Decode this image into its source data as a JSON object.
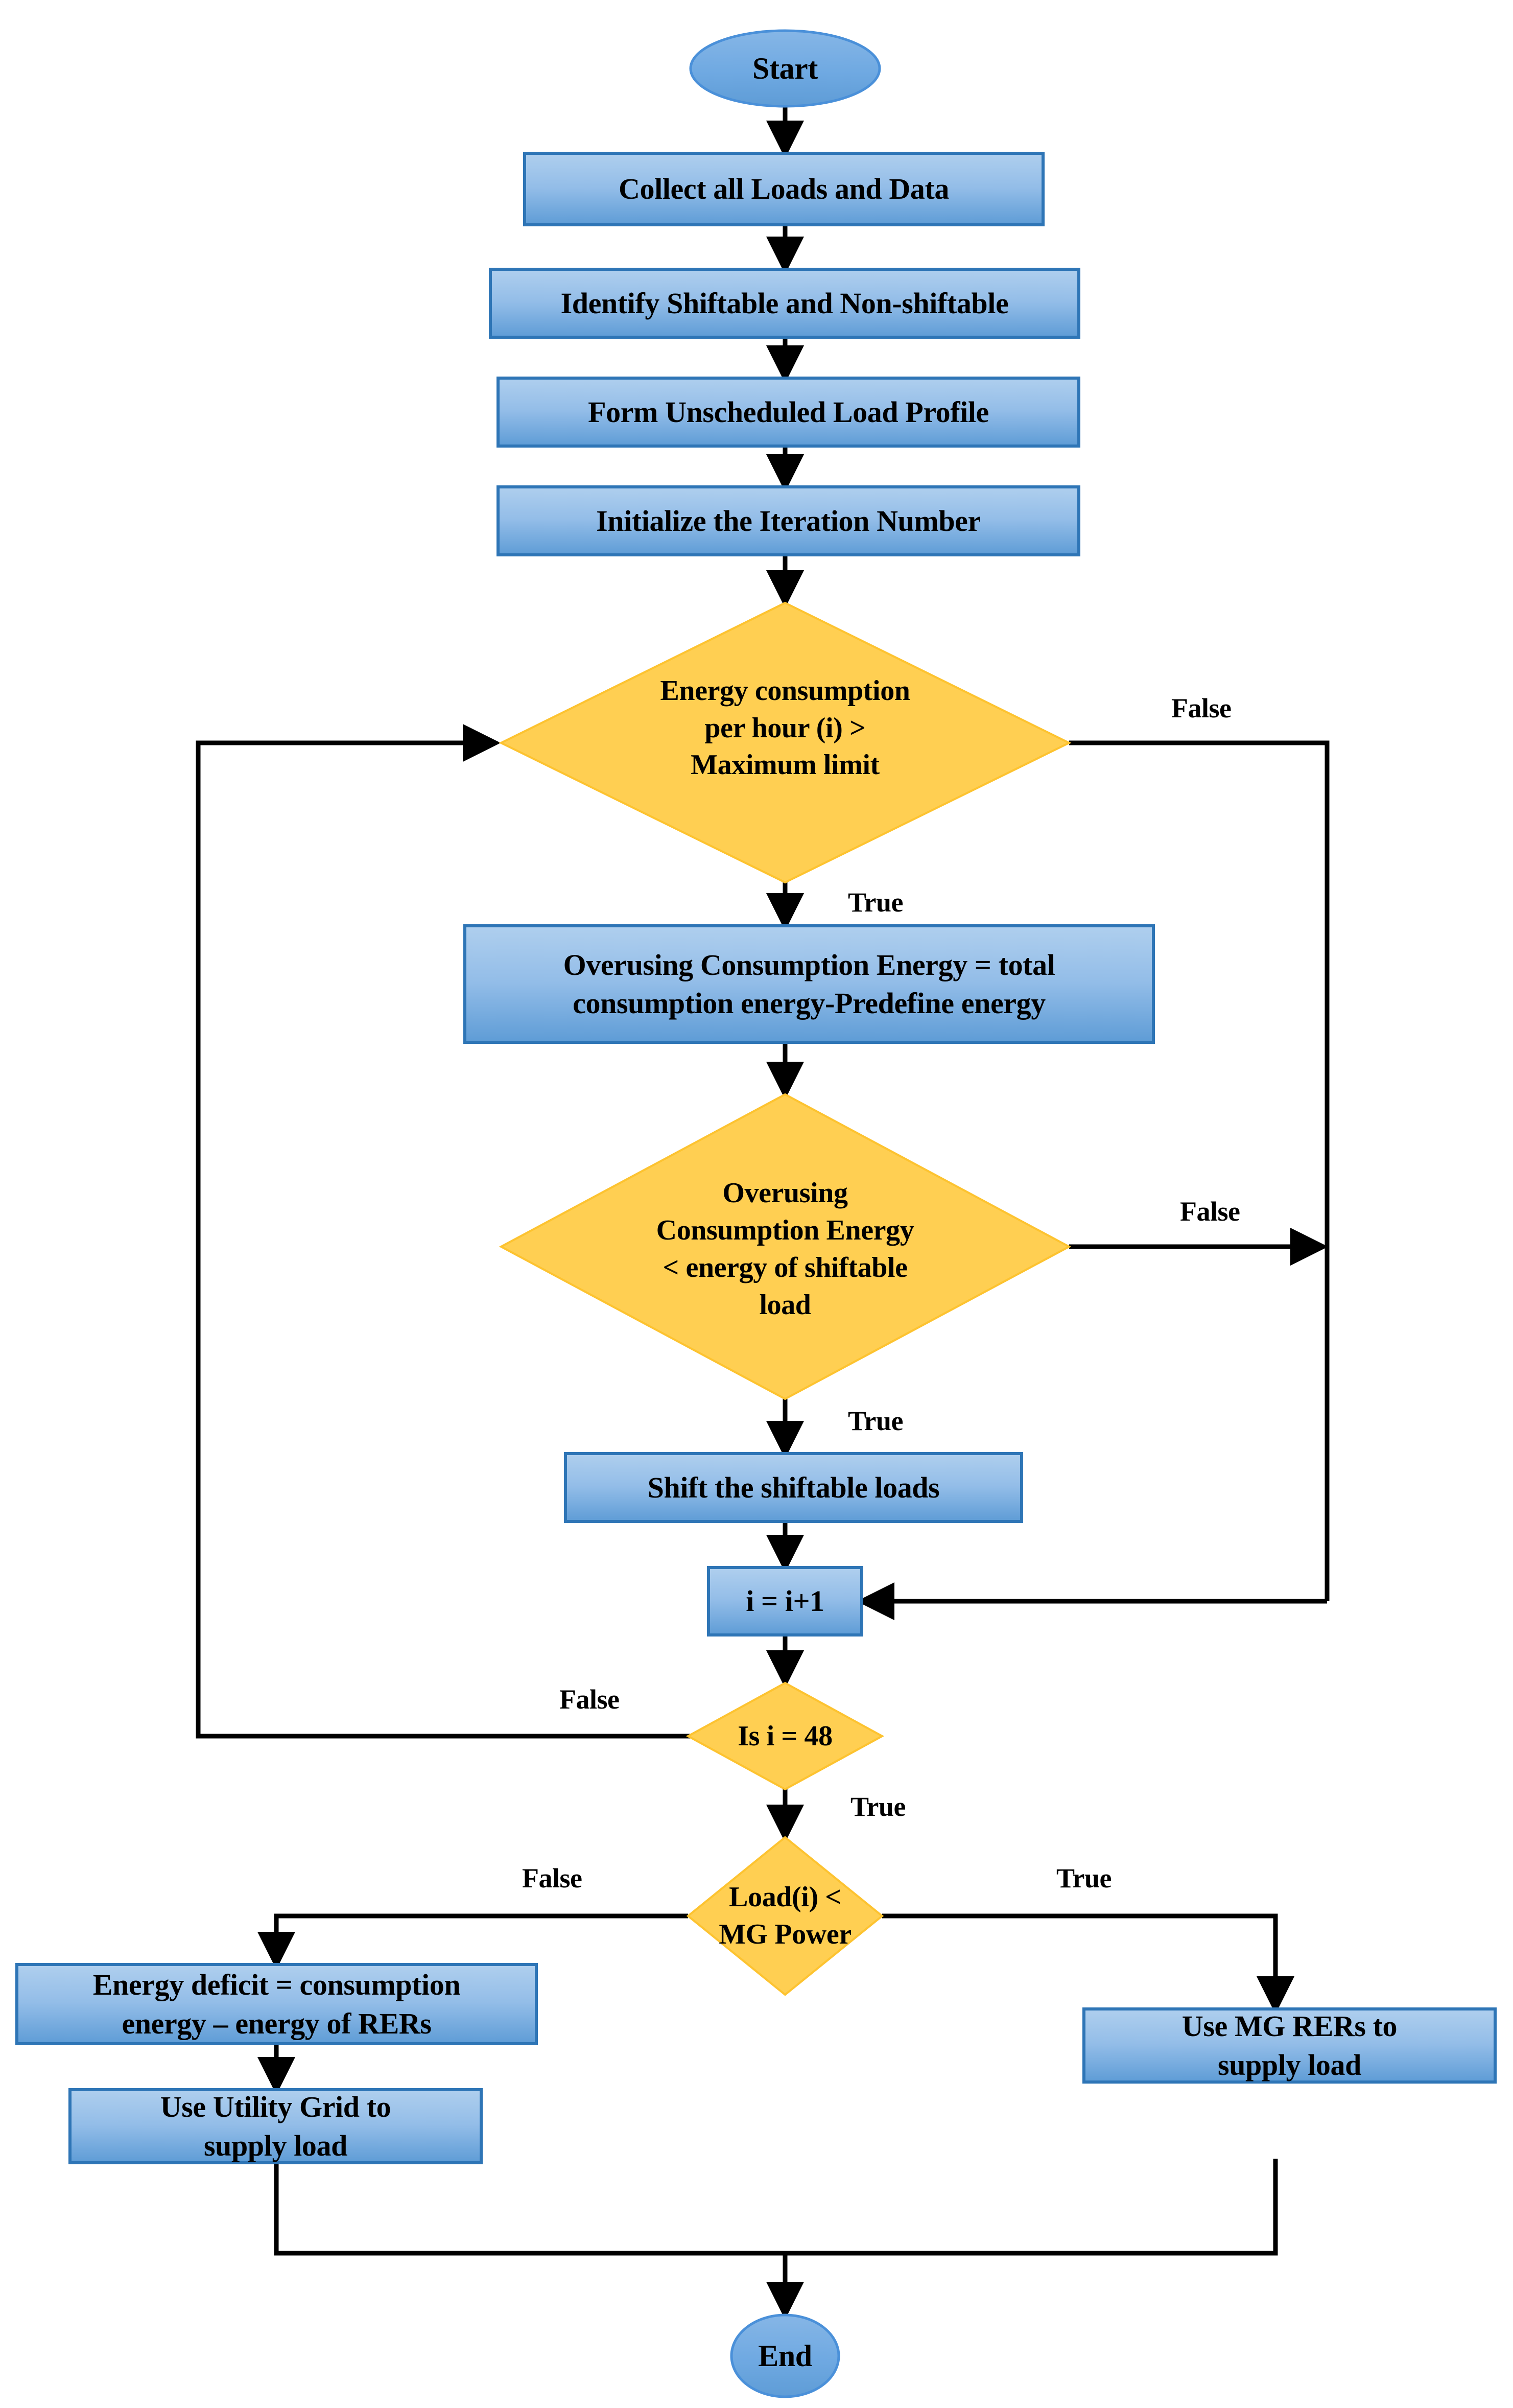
{
  "diagram": {
    "title": "Energy Management Load Scheduling Flowchart",
    "colors": {
      "process_fill_light": "#A8CBEC",
      "process_fill_dark": "#5B9BD5",
      "process_stroke": "#2E75B6",
      "decision_fill": "#FFCF52",
      "decision_stroke": "#FDC330",
      "terminal_fill": "#6FAAE4",
      "terminal_stroke": "#4A90D9",
      "connector": "#000000",
      "background": "#FFFFFF"
    },
    "nodes": {
      "start": {
        "shape": "terminal",
        "text": "Start"
      },
      "collect": {
        "shape": "process",
        "text": "Collect all Loads and Data"
      },
      "identify": {
        "shape": "process",
        "text": "Identify Shiftable and Non-shiftable"
      },
      "form_profile": {
        "shape": "process",
        "text": "Form Unscheduled Load Profile"
      },
      "init_iteration": {
        "shape": "process",
        "text": "Initialize the Iteration Number"
      },
      "decision_energy": {
        "shape": "decision",
        "text": "Energy consumption\nper hour (i) >\nMaximum limit"
      },
      "overusing_calc": {
        "shape": "process",
        "text": "Overusing Consumption Energy = total\nconsumption energy-Predefine energy"
      },
      "decision_overusing": {
        "shape": "decision",
        "text": "Overusing\nConsumption Energy\n< energy of shiftable\nload"
      },
      "shift_loads": {
        "shape": "process",
        "text": "Shift the shiftable loads"
      },
      "increment": {
        "shape": "process",
        "text": "i = i+1"
      },
      "decision_i48": {
        "shape": "decision",
        "text": "Is i = 48"
      },
      "decision_load_mg": {
        "shape": "decision",
        "text": "Load(i) <\nMG Power"
      },
      "energy_deficit": {
        "shape": "process",
        "text": "Energy deficit = consumption\nenergy – energy of RERs"
      },
      "use_utility_grid": {
        "shape": "process",
        "text": "Use Utility Grid to\nsupply load"
      },
      "use_mg_rers": {
        "shape": "process",
        "text": "Use MG RERs to\nsupply load"
      },
      "end": {
        "shape": "terminal",
        "text": "End"
      }
    },
    "edge_labels": {
      "energy_false": "False",
      "energy_true": "True",
      "overusing_false": "False",
      "overusing_true": "True",
      "i48_false": "False",
      "i48_true": "True",
      "loadmg_false": "False",
      "loadmg_true": "True"
    }
  }
}
